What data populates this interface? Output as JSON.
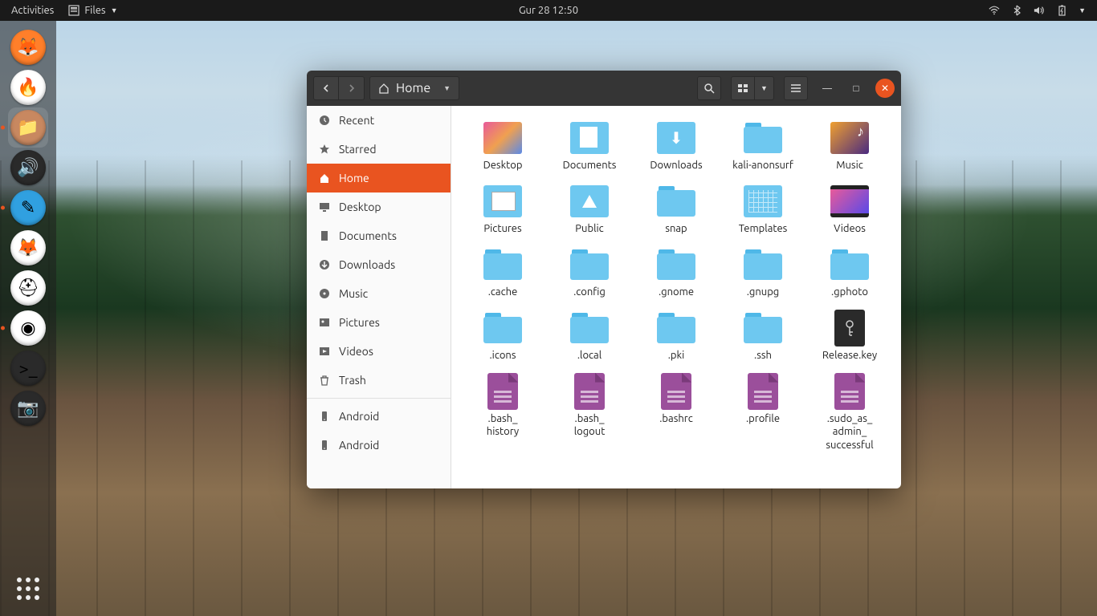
{
  "topbar": {
    "activities": "Activities",
    "app_label": "Files",
    "clock": "Gur 28  12:50"
  },
  "dock": {
    "items": [
      {
        "name": "firefox",
        "bg": "#ff7f2a",
        "letter": "🦊"
      },
      {
        "name": "gnome-web",
        "bg": "#ffffff",
        "letter": "🔥"
      },
      {
        "name": "files",
        "bg": "#c88860",
        "letter": "📁",
        "active": true,
        "running": true
      },
      {
        "name": "rhythmbox",
        "bg": "#2a2a2a",
        "letter": "🔊"
      },
      {
        "name": "gedit",
        "bg": "#30a0e0",
        "letter": "✎",
        "running": true
      },
      {
        "name": "software",
        "bg": "#ffffff",
        "letter": "🦊"
      },
      {
        "name": "help",
        "bg": "#ffffff",
        "letter": "⛑"
      },
      {
        "name": "chrome",
        "bg": "#ffffff",
        "letter": "◉",
        "running": true
      },
      {
        "name": "terminal",
        "bg": "#2a2a2a",
        "letter": ">_"
      },
      {
        "name": "camera",
        "bg": "#2a2a2a",
        "letter": "📷"
      }
    ]
  },
  "window": {
    "path_label": "Home",
    "sidebar": [
      {
        "icon": "clock",
        "label": "Recent"
      },
      {
        "icon": "star",
        "label": "Starred"
      },
      {
        "icon": "home",
        "label": "Home",
        "active": true
      },
      {
        "icon": "desktop",
        "label": "Desktop"
      },
      {
        "icon": "docs",
        "label": "Documents"
      },
      {
        "icon": "download",
        "label": "Downloads"
      },
      {
        "icon": "music",
        "label": "Music"
      },
      {
        "icon": "pictures",
        "label": "Pictures"
      },
      {
        "icon": "videos",
        "label": "Videos"
      },
      {
        "icon": "trash",
        "label": "Trash"
      },
      {
        "sep": true
      },
      {
        "icon": "phone",
        "label": "Android"
      },
      {
        "icon": "phone",
        "label": "Android"
      }
    ],
    "files": [
      {
        "type": "desktop",
        "label": "Desktop"
      },
      {
        "type": "docs",
        "label": "Documents"
      },
      {
        "type": "download",
        "label": "Downloads"
      },
      {
        "type": "folder",
        "label": "kali-anonsurf"
      },
      {
        "type": "music",
        "label": "Music"
      },
      {
        "type": "pictures",
        "label": "Pictures"
      },
      {
        "type": "public",
        "label": "Public"
      },
      {
        "type": "folder",
        "label": "snap"
      },
      {
        "type": "templates",
        "label": "Templates"
      },
      {
        "type": "videos",
        "label": "Videos"
      },
      {
        "type": "folder",
        "label": ".cache"
      },
      {
        "type": "folder",
        "label": ".config"
      },
      {
        "type": "folder",
        "label": ".gnome"
      },
      {
        "type": "folder",
        "label": ".gnupg"
      },
      {
        "type": "folder",
        "label": ".gphoto"
      },
      {
        "type": "folder",
        "label": ".icons"
      },
      {
        "type": "folder",
        "label": ".local"
      },
      {
        "type": "folder",
        "label": ".pki"
      },
      {
        "type": "folder",
        "label": ".ssh"
      },
      {
        "type": "key",
        "label": "Release.key"
      },
      {
        "type": "doc",
        "label": ".bash_\nhistory"
      },
      {
        "type": "doc",
        "label": ".bash_\nlogout"
      },
      {
        "type": "doc",
        "label": ".bashrc"
      },
      {
        "type": "doc",
        "label": ".profile"
      },
      {
        "type": "doc",
        "label": ".sudo_as_\nadmin_\nsuccessful"
      }
    ]
  }
}
